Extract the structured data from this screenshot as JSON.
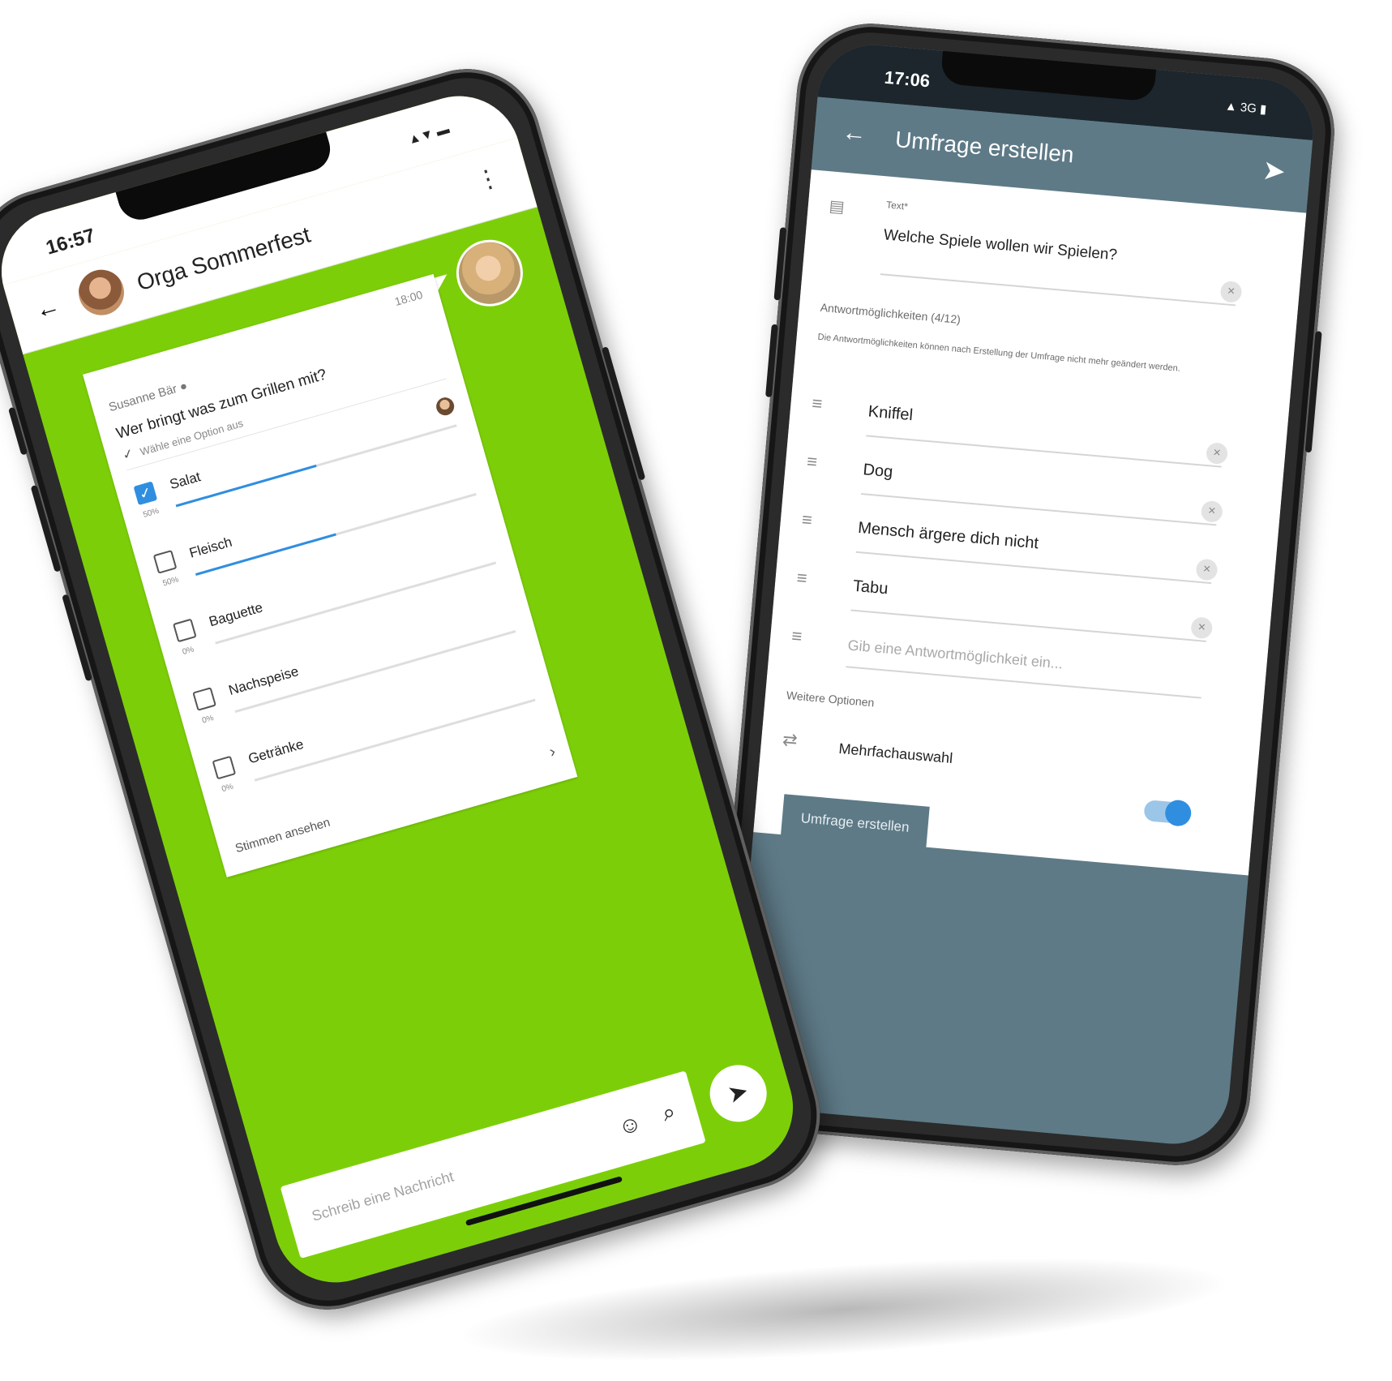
{
  "left_phone": {
    "status": {
      "time": "16:57",
      "icons": "▲▼ ▬"
    },
    "header": {
      "back_icon": "←",
      "title": "Orga Sommerfest",
      "more_icon": "⋮"
    },
    "poll_message": {
      "time": "18:00",
      "sender": "Susanne Bär ●",
      "question": "Wer bringt was zum Grillen mit?",
      "hint": "Wähle eine Option aus",
      "hint_check": "✓",
      "options": [
        {
          "label": "Salat",
          "checked": true,
          "pct": "50%",
          "fill": 0.5,
          "has_voter": true
        },
        {
          "label": "Fleisch",
          "checked": false,
          "pct": "50%",
          "fill": 0.5,
          "has_voter": false
        },
        {
          "label": "Baguette",
          "checked": false,
          "pct": "0%",
          "fill": 0,
          "has_voter": false
        },
        {
          "label": "Nachspeise",
          "checked": false,
          "pct": "0%",
          "fill": 0,
          "has_voter": false
        },
        {
          "label": "Getränke",
          "checked": false,
          "pct": "0%",
          "fill": 0,
          "has_voter": false
        }
      ],
      "check_mark": "✓",
      "chevron": "›",
      "votes_link": "Stimmen ansehen"
    },
    "composer": {
      "placeholder": "Schreib eine Nachricht",
      "emoji_icon": "☺",
      "attach_icon": "⌕",
      "send_icon": "➤"
    }
  },
  "right_phone": {
    "status": {
      "time": "17:06",
      "icons": "▲ 3G ▮"
    },
    "appbar": {
      "back_icon": "←",
      "title": "Umfrage erstellen",
      "send_icon": "➤"
    },
    "form": {
      "text_label": "Text*",
      "text_value": "Welche Spiele wollen wir Spielen?",
      "text_icon": "▤",
      "answers_label": "Antwortmöglichkeiten (4/12)",
      "answers_hint": "Die Antwortmöglichkeiten können nach Erstellung der Umfrage nicht mehr geändert werden.",
      "answers": [
        "Kniffel",
        "Dog",
        "Mensch ärgere dich nicht",
        "Tabu"
      ],
      "new_answer_placeholder": "Gib eine Antwortmöglichkeit ein...",
      "clear_icon": "×",
      "handle_icon": "≡",
      "more_options_label": "Weitere Optionen",
      "multi_icon": "⇄",
      "multi_label": "Mehrfachauswahl",
      "multi_enabled": true,
      "create_button": "Umfrage erstellen"
    }
  }
}
